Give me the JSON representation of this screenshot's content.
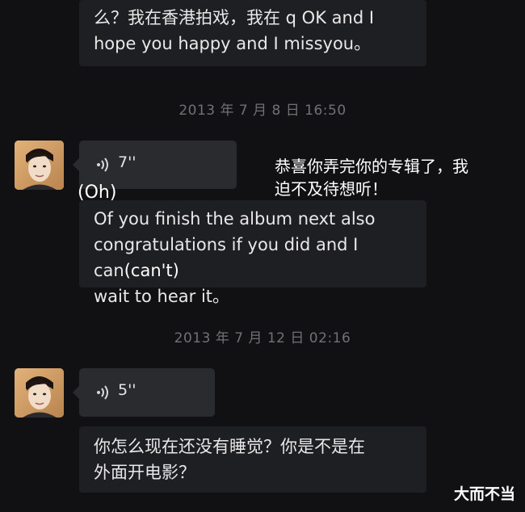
{
  "messages": {
    "top_text_line1": "么？我在香港拍戏，我在 q OK and I",
    "top_text_line2": "hope you happy and I missyou。",
    "timestamp1": "2013 年 7 月 8 日 16:50",
    "voice1_duration": "7''",
    "annotation1_line1": "恭喜你弄完你的专辑了，我",
    "annotation1_line2": "迫不及待想听！",
    "annotation_oh": "(Oh)",
    "text2_line1": "Of you finish the album next also",
    "text2_line2_a": "congratulations if you did and I can",
    "text2_line2_b": "(can't)",
    "text2_line3": "wait to hear it。",
    "timestamp2": "2013 年 7 月 12 日 02:16",
    "voice2_duration": "5''",
    "text3_line1": "你怎么现在还没有睡觉？你是不是在",
    "text3_line2": "外面开电影？"
  },
  "watermark": "大而不当",
  "icons": {
    "avatar": "avatar-photo",
    "voice": "voice-wave-icon"
  },
  "colors": {
    "background": "#111114",
    "bubble": "#1e1f22",
    "voice_bubble": "#2a2b2f",
    "timestamp": "#707076",
    "avatar_skin": "#c9965c"
  }
}
